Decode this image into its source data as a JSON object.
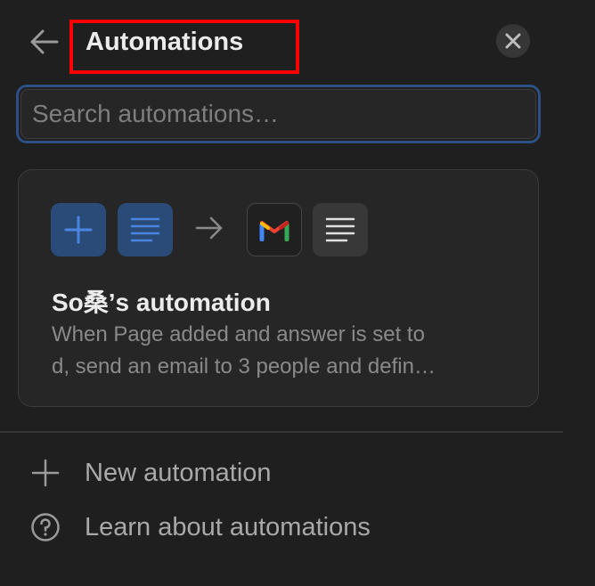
{
  "header": {
    "title": "Automations",
    "back_icon": "arrow-left-icon",
    "close_icon": "close-icon"
  },
  "search": {
    "placeholder": "Search automations…",
    "value": ""
  },
  "automation_card": {
    "title": "So桑’s automation",
    "description_line1": "When Page added and answer is set to",
    "description_line2": "d, send an email to 3 people and defin…",
    "trigger_icons": [
      "plus-icon",
      "page-text-icon"
    ],
    "action_icons": [
      "gmail-icon",
      "text-lines-icon"
    ]
  },
  "menu": {
    "new_automation": "New automation",
    "learn_about": "Learn about automations"
  },
  "colors": {
    "background": "#1f1f1f",
    "accent_blue": "#4a86e0",
    "highlight_box": "#ff0000"
  }
}
